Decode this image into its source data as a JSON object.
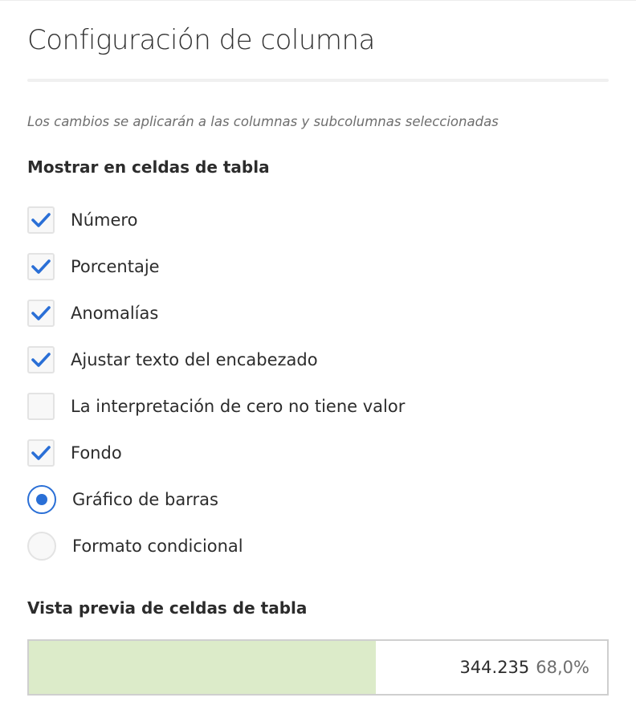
{
  "panel": {
    "title": "Configuración de columna",
    "note": "Los cambios se aplicarán a las columnas y subcolumnas seleccionadas"
  },
  "display_section": {
    "heading": "Mostrar en celdas de tabla",
    "options": [
      {
        "label": "Número",
        "type": "checkbox",
        "checked": true
      },
      {
        "label": "Porcentaje",
        "type": "checkbox",
        "checked": true
      },
      {
        "label": "Anomalías",
        "type": "checkbox",
        "checked": true
      },
      {
        "label": "Ajustar texto del encabezado",
        "type": "checkbox",
        "checked": true
      },
      {
        "label": "La interpretación de cero no tiene valor",
        "type": "checkbox",
        "checked": false
      },
      {
        "label": "Fondo",
        "type": "checkbox",
        "checked": true
      },
      {
        "label": "Gráfico de barras",
        "type": "radio",
        "checked": true
      },
      {
        "label": "Formato condicional",
        "type": "radio",
        "checked": false
      }
    ]
  },
  "preview_section": {
    "heading": "Vista previa de celdas de tabla",
    "number": "344.235",
    "percent": "68,0%",
    "bar_fraction": 0.6,
    "bar_color": "#dcebc9"
  },
  "colors": {
    "accent": "#2a6fd6",
    "checkmark": "#2a6fd6"
  },
  "icons": {
    "checked": "checkmark-icon",
    "radio_selected": "radio-dot-icon"
  }
}
